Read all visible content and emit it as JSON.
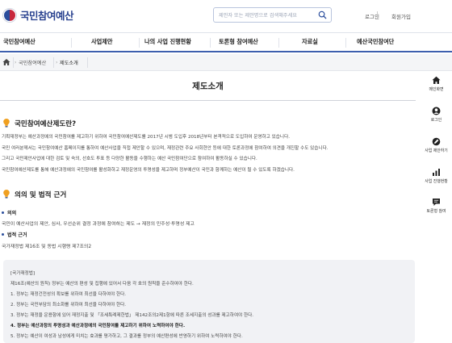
{
  "header": {
    "logo_text": "국민참여예산",
    "search_placeholder": "제안자 또는 제안명으로 검색해주세요",
    "login": "로그인",
    "signup": "회원가입"
  },
  "nav": {
    "items": [
      "국민참여예산",
      "사업제안",
      "나의 사업 진행현황",
      "토론형 참여예산",
      "자료실",
      "예산국민참여단"
    ]
  },
  "breadcrumb": {
    "items": [
      "국민참여예산",
      "제도소개"
    ]
  },
  "page": {
    "title": "제도소개"
  },
  "section1": {
    "title": "국민참여예산제도란?",
    "lines": [
      "기획재정부는 예산과정에의 국민참여를 제고하기 위하여 국민참여예산제도를 2017년 시범 도입후 2018년부터 본격적으로 도입하여 운영하고 있습니다.",
      "국민 여러분께서는 국민참여예산 홈페이지를 통하여 예산사업을 직접 제안할 수 있으며, 재정관련 주요 사회현안 등에 대한 토론과정에 참여하여 의견을 개진할 수도 있습니다.",
      "그리고 국민제안사업에 대한 검토 및 숙의, 선호도 투표 등 다양한 활동을 수행하는 예산 국민참여단으로 참여하여 활동하실 수 있습니다.",
      "국민참여예산제도를 통해 예산과정에의 국민참여를 활성화하고 재정운영의 투명성을 제고하며 정부예산이 국민과 함께하는 예산이 될 수 있도록 하겠습니다."
    ]
  },
  "section2": {
    "title": "의의 및 법적 근거",
    "significance_label": "의의",
    "significance_text": "국민이 예산사업의 제안, 심사, 우선순위 결정 과정에 참여하는 제도 → 재정의 민주성·투명성 제고",
    "legal_label": "법적 근거",
    "legal_text": "국가재정법 제16조 및 동법 시행령 제7조의2"
  },
  "lawbox": {
    "lines": [
      {
        "text": "[국가재정법]",
        "bold": false
      },
      {
        "text": "제16조(예산의 원칙) 정부는 예산의 편성 및 집행에 있어서 다음 각 호의 원칙을 준수하여야 한다.",
        "bold": false
      },
      {
        "text": "1. 정부는 재정건전성의 확보를 위하여 최선을 다하여야 한다.",
        "bold": false
      },
      {
        "text": "2. 정부는 국민부담의 최소화를 위하여 최선을 다하여야 한다.",
        "bold": false
      },
      {
        "text": "3. 정부는 재정을 운용함에 있어 재정지출 및 「조세특례제한법」 제142조의2제1항에 따른 조세지출의 성과를 제고하여야 한다.",
        "bold": false
      },
      {
        "text": "4. 정부는 예산과정의 투명성과 예산과정에의 국민참여를 제고하기 위하여 노력하여야 한다.",
        "bold": true
      },
      {
        "text": "5. 정부는 예산이 여성과 남성에게 미치는 효과를 평가하고, 그 결과를 정부의 예산편성에 반영하기 위하여 노력하여야 한다.",
        "bold": false
      }
    ]
  },
  "quick_menu": {
    "items": [
      {
        "label": "메인화면",
        "icon": "home-icon"
      },
      {
        "label": "로그인",
        "icon": "user-icon"
      },
      {
        "label": "사업 제안하기",
        "icon": "propose-icon"
      },
      {
        "label": "사업 진행현황",
        "icon": "chart-icon"
      },
      {
        "label": "토론형 참여",
        "icon": "discussion-icon"
      }
    ]
  },
  "colors": {
    "brand_blue": "#2a4390",
    "nav_underline": "#3d5fae",
    "bulb_orange": "#f0a020"
  }
}
